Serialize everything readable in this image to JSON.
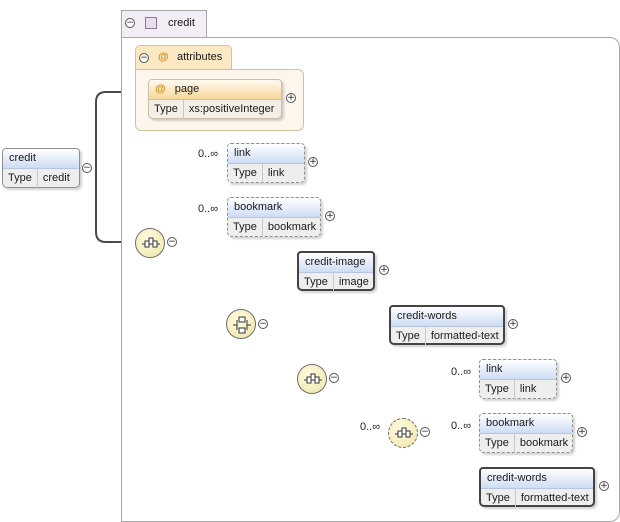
{
  "root": {
    "name": "credit",
    "type_label": "Type",
    "type_value": "credit"
  },
  "complex_type": {
    "name": "credit"
  },
  "attributes": {
    "group_label": "attributes",
    "at_symbol": "@",
    "items": [
      {
        "name": "page",
        "type_label": "Type",
        "type_value": "xs:positiveInteger"
      }
    ]
  },
  "elements": {
    "link1": {
      "name": "link",
      "type_label": "Type",
      "type_value": "link",
      "cardinality": "0..∞"
    },
    "bookmark1": {
      "name": "bookmark",
      "type_label": "Type",
      "type_value": "bookmark",
      "cardinality": "0..∞"
    },
    "credit_image": {
      "name": "credit-image",
      "type_label": "Type",
      "type_value": "image"
    },
    "credit_words1": {
      "name": "credit-words",
      "type_label": "Type",
      "type_value": "formatted-text"
    },
    "link2": {
      "name": "link",
      "type_label": "Type",
      "type_value": "link",
      "cardinality": "0..∞"
    },
    "bookmark2": {
      "name": "bookmark",
      "type_label": "Type",
      "type_value": "bookmark",
      "cardinality": "0..∞"
    },
    "credit_words2": {
      "name": "credit-words",
      "type_label": "Type",
      "type_value": "formatted-text"
    }
  },
  "group_cardinality": "0..∞",
  "buttons": {
    "collapse": "−",
    "expand": "+"
  },
  "colors": {
    "wire": "#4a4a4a",
    "wire_optional": "#cfcfcf",
    "header_blue": "#cddcf4",
    "attr_orange": "#f8d89a"
  }
}
